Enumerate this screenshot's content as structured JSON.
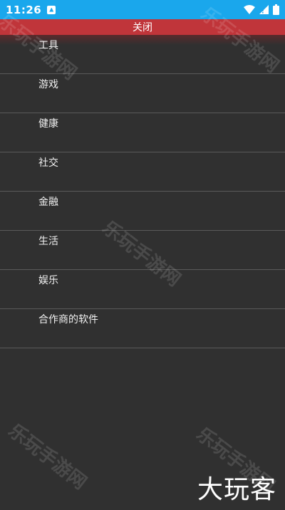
{
  "status_bar": {
    "time": "11:26",
    "notification_icon": "a-notification-icon",
    "wifi_icon": "wifi-icon",
    "signal_icon": "signal-icon",
    "battery_icon": "battery-icon",
    "background_color": "#1aa7ec"
  },
  "close_bar": {
    "label": "关闭",
    "background_color": "#c0353a"
  },
  "menu": {
    "items": [
      {
        "label": "工具"
      },
      {
        "label": "游戏"
      },
      {
        "label": "健康"
      },
      {
        "label": "社交"
      },
      {
        "label": "金融"
      },
      {
        "label": "生活"
      },
      {
        "label": "娱乐"
      },
      {
        "label": "合作商的软件"
      }
    ]
  },
  "watermarks": {
    "text": "乐玩手游网"
  },
  "brand": {
    "text": "大玩客"
  }
}
